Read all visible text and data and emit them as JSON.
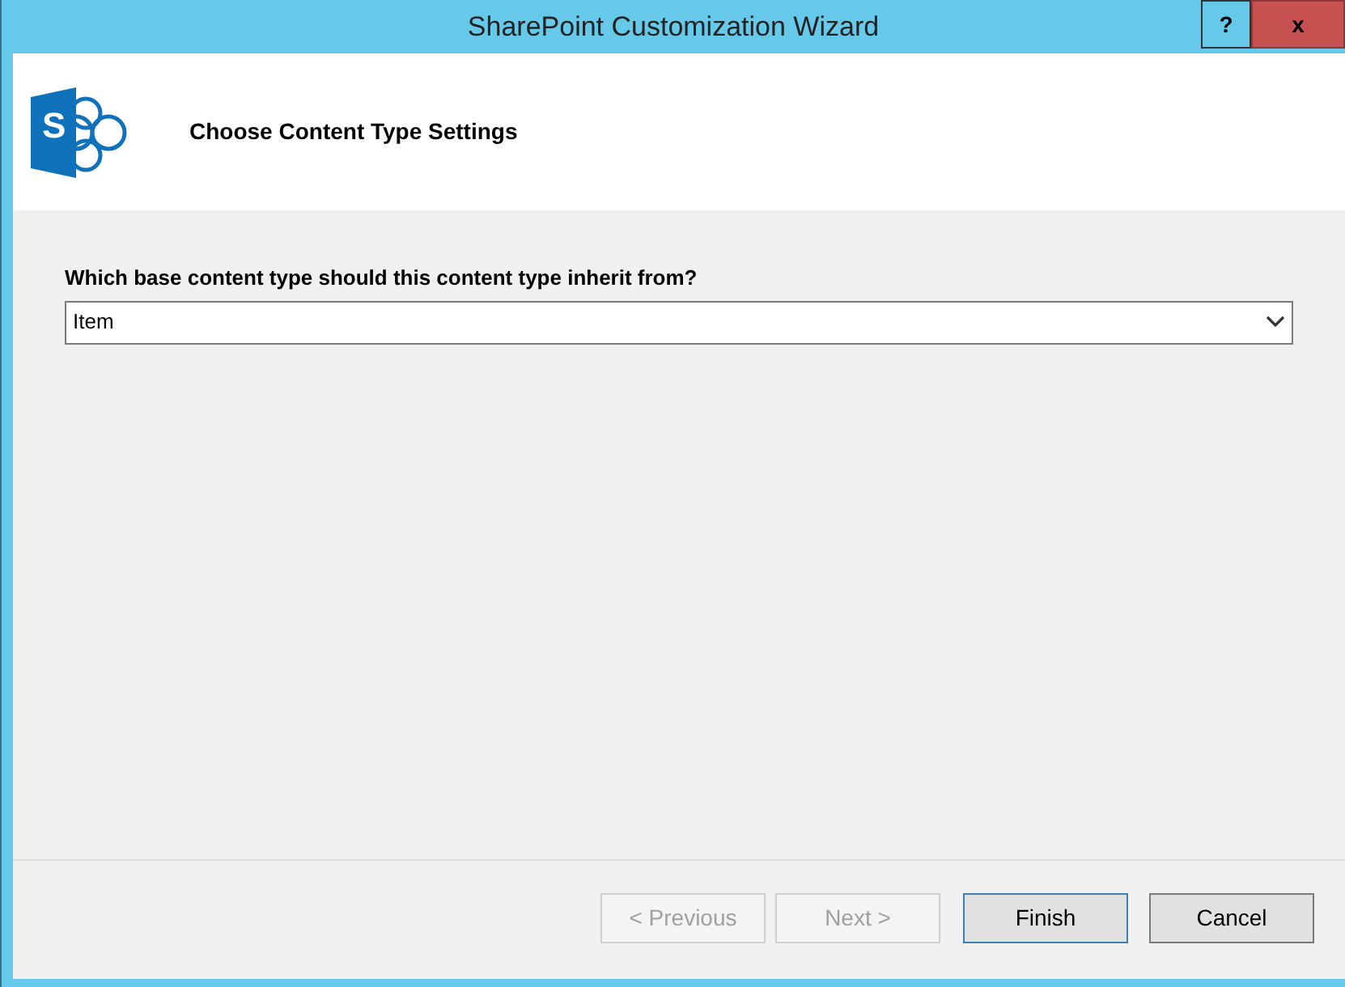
{
  "window": {
    "title": "SharePoint Customization Wizard",
    "controls": [
      {
        "kind": "help",
        "label": "?"
      },
      {
        "kind": "close",
        "label": "x"
      }
    ]
  },
  "header": {
    "logo_letter": "S",
    "title": "Choose Content Type Settings"
  },
  "question": {
    "label": "Which base content type should this content type inherit from?",
    "value": "Item"
  },
  "buttons": [
    {
      "label": "< Previous",
      "disabled": true,
      "default": false
    },
    {
      "label": "Next >",
      "disabled": true,
      "default": false
    },
    {
      "label": "Finish",
      "disabled": false,
      "default": true
    },
    {
      "label": "Cancel",
      "disabled": false,
      "default": false
    }
  ]
}
